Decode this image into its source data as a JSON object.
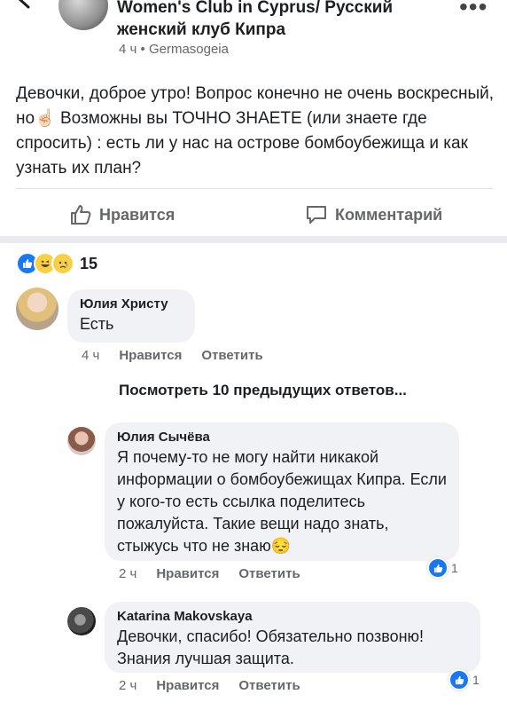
{
  "post": {
    "group_title": "Women's Club in Cyprus/ Русский женский клуб Кипра",
    "time": "4 ч",
    "separator": "•",
    "location": "Germasogeia",
    "text_part1": "Девочки, доброе утро! Вопрос конечно не очень воскресный, но",
    "emoji_finger": "☝🏻",
    "text_part2": " Возможны вы ТОЧНО ЗНАЕТЕ (или знаете где спросить) : есть ли у нас на острове бомбоубежища и как узнать их план?"
  },
  "actions": {
    "like_label": "Нравится",
    "comment_label": "Комментарий"
  },
  "reactions": {
    "icons": [
      "like",
      "haha",
      "sad"
    ],
    "count": "15"
  },
  "comments": [
    {
      "author": "Юлия Христу",
      "text": "Есть",
      "time": "4 ч",
      "like": "Нравится",
      "reply": "Ответить"
    }
  ],
  "view_more": "Посмотреть 10 предыдущих ответов...",
  "replies": [
    {
      "author": "Юлия Сычёва",
      "text": "Я почему-то не могу найти никакой информации о бомбоубежищах Кипра. Если у кого-то есть ссылка поделитесь пожалуйста. Такие вещи надо знать, стыжусь что не знаю",
      "emoji": "😔",
      "time": "2 ч",
      "like": "Нравится",
      "reply": "Ответить",
      "likes": "1"
    },
    {
      "author": "Katarina Makovskaya",
      "text": "Девочки, спасибо! Обязательно позвоню! Знания лучшая защита.",
      "time": "2 ч",
      "like": "Нравится",
      "reply": "Ответить",
      "likes": "1"
    }
  ],
  "colors": {
    "brand_blue": "#1877f2",
    "text_secondary": "#65676b",
    "bubble_bg": "#f0f2f5"
  }
}
